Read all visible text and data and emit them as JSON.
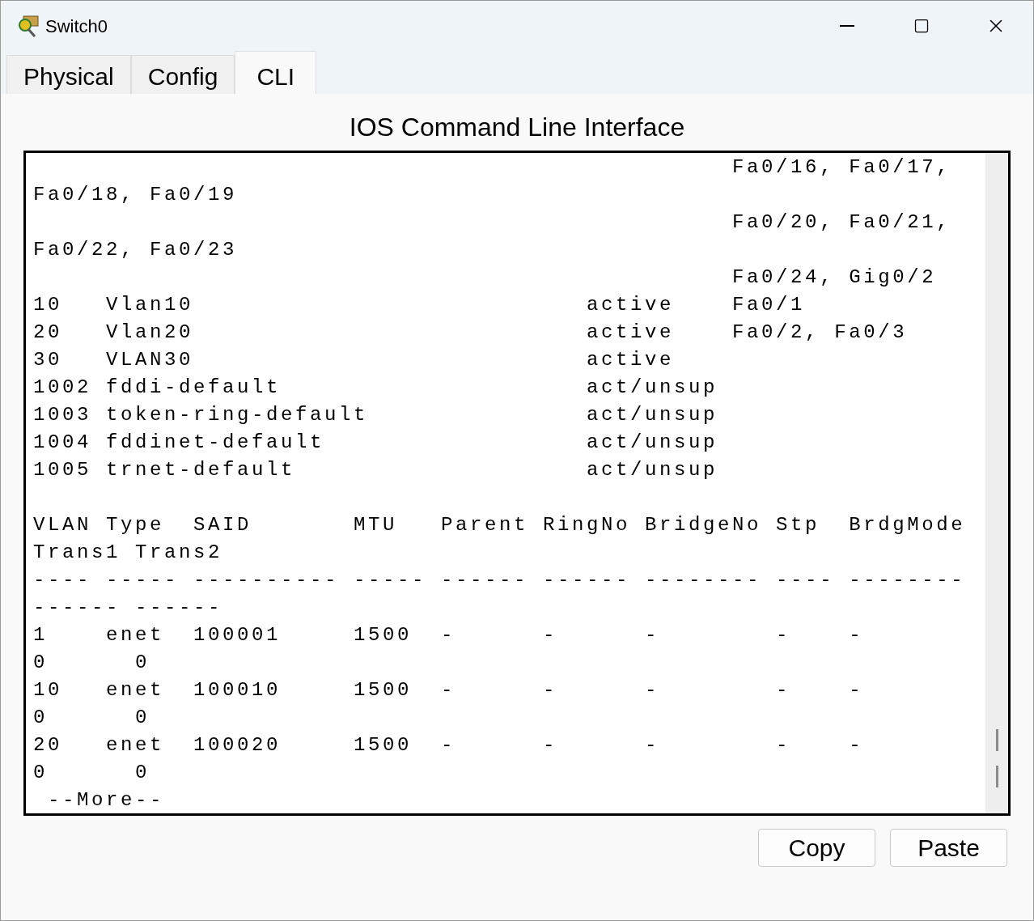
{
  "window": {
    "title": "Switch0"
  },
  "tabs": [
    {
      "label": "Physical",
      "selected": false
    },
    {
      "label": "Config",
      "selected": false
    },
    {
      "label": "CLI",
      "selected": true
    }
  ],
  "heading": "IOS Command Line Interface",
  "terminal": {
    "blocks": [
      [
        "                                                Fa0/16, Fa0/17,",
        "Fa0/18, Fa0/19",
        "                                                Fa0/20, Fa0/21,",
        "Fa0/22, Fa0/23",
        "                                                Fa0/24, Gig0/2",
        "10   Vlan10                           active    Fa0/1",
        "20   Vlan20                           active    Fa0/2, Fa0/3",
        "30   VLAN30                           active",
        "1002 fddi-default                     act/unsup",
        "1003 token-ring-default               act/unsup",
        "1004 fddinet-default                  act/unsup",
        "1005 trnet-default                    act/unsup"
      ],
      [
        "VLAN Type  SAID       MTU   Parent RingNo BridgeNo Stp  BrdgMode",
        "Trans1 Trans2",
        "---- ----- ---------- ----- ------ ------ -------- ---- --------",
        "------ ------",
        "1    enet  100001     1500  -      -      -        -    -",
        "0      0",
        "10   enet  100010     1500  -      -      -        -    -",
        "0      0",
        "20   enet  100020     1500  -      -      -        -    -",
        "0      0",
        " --More--"
      ]
    ]
  },
  "buttons": [
    "Copy",
    "Paste"
  ]
}
